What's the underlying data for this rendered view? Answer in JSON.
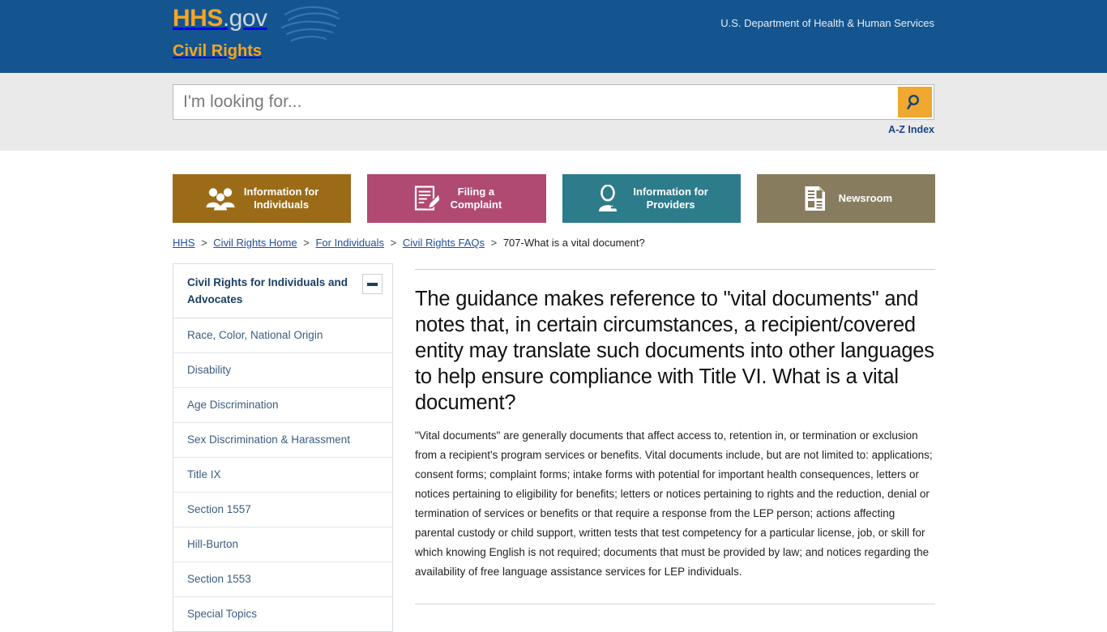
{
  "banner": {
    "logo_primary": "HHS",
    "logo_secondary": ".gov",
    "logo_subtitle": "Civil Rights",
    "department_title": "U.S. Department of Health & Human Services",
    "bird_icon": "hhs-bird-logo-icon",
    "background_color": "#14558F",
    "accent_color": "#F5A623"
  },
  "search": {
    "placeholder": "I'm looking for...",
    "value": "",
    "button_icon": "search-icon",
    "button_color": "#F0A830",
    "az_index_label": "A-Z Index"
  },
  "cards": [
    {
      "label": "Information for\nIndividuals",
      "icon": "people-group-icon",
      "color": "#9C6B17"
    },
    {
      "label": "Filing a\nComplaint",
      "icon": "form-pencil-icon",
      "color": "#B04A72"
    },
    {
      "label": "Information for\nProviders",
      "icon": "doctor-person-icon",
      "color": "#2C7C8C"
    },
    {
      "label": "Newsroom",
      "icon": "newspaper-document-icon",
      "color": "#887C5E"
    }
  ],
  "breadcrumb": {
    "items": [
      {
        "label": "HHS",
        "link": true
      },
      {
        "label": "Civil Rights Home",
        "link": true
      },
      {
        "label": "For Individuals",
        "link": true
      },
      {
        "label": "Civil Rights FAQs",
        "link": true
      },
      {
        "label": "707-What is a vital document?",
        "link": false
      }
    ],
    "separator": ">"
  },
  "sidebar": {
    "title": "Civil Rights for Individuals and Advocates",
    "collapse_icon": "minus-icon",
    "items": [
      {
        "label": "Race, Color, National Origin"
      },
      {
        "label": "Disability"
      },
      {
        "label": "Age Discrimination"
      },
      {
        "label": "Sex Discrimination & Harassment"
      },
      {
        "label": "Title IX"
      },
      {
        "label": "Section 1557"
      },
      {
        "label": "Hill-Burton"
      },
      {
        "label": "Section 1553"
      },
      {
        "label": "Special Topics"
      }
    ]
  },
  "article": {
    "title": "The guidance makes reference to \"vital documents\" and notes that, in certain circumstances, a recipient/covered entity may translate such documents into other languages to help ensure compliance with Title VI. What is a vital document?",
    "body": "\"Vital documents\" are generally documents that affect access to, retention in, or termination or exclusion from a recipient's program services or benefits. Vital documents include, but are not limited to: applications; consent forms; complaint forms; intake forms with potential for important health consequences, letters or notices pertaining to eligibility for benefits; letters or notices pertaining to rights and the reduction, denial or termination of services or benefits or that require a response from the LEP person; actions affecting parental custody or child support, written tests that test competency for a particular license, job, or skill for which knowing English is not required; documents that must be provided by law; and notices regarding the availability of free language assistance services for LEP individuals."
  }
}
